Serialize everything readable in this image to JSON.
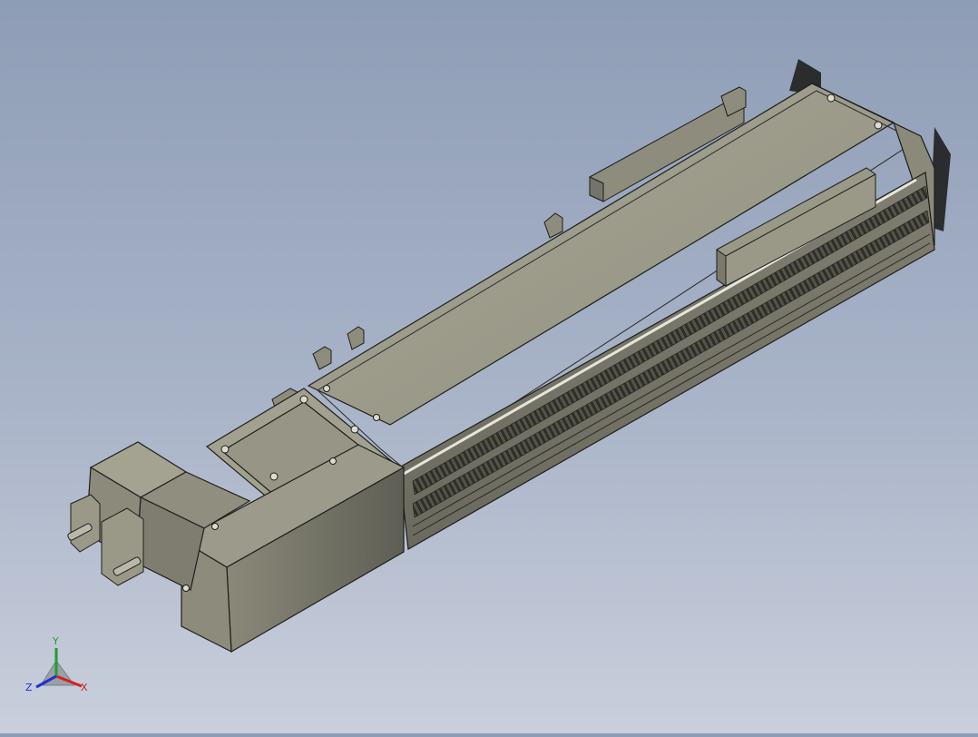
{
  "viewport": {
    "background_top": "#8e9db6",
    "background_bottom": "#c9cfdc",
    "model_color": "#9c9b8b",
    "edge_color": "#1e1e1a"
  },
  "triad": {
    "x_label": "X",
    "y_label": "Y",
    "z_label": "Z",
    "x_color": "#d42020",
    "y_color": "#1fa02a",
    "z_color": "#2030d0"
  }
}
